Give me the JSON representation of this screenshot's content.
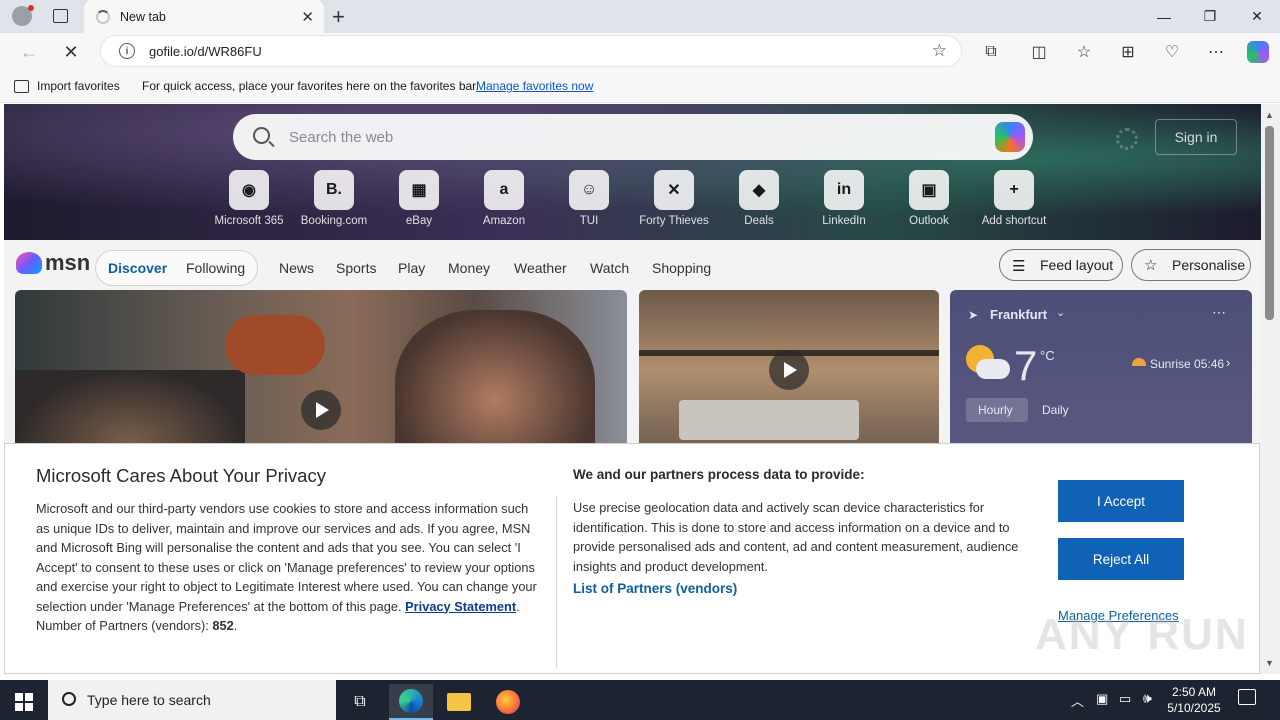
{
  "browser": {
    "tab_title": "New tab",
    "url": "gofile.io/d/WR86FU",
    "favorites": {
      "import_label": "Import favorites",
      "message": "For quick access, place your favorites here on the favorites bar.",
      "manage_link": "Manage favorites now"
    }
  },
  "newtab": {
    "search_placeholder": "Search the web",
    "signin_label": "Sign in",
    "shortcuts": [
      {
        "label": "Microsoft 365",
        "glyph": "◉"
      },
      {
        "label": "Booking.com",
        "glyph": "B."
      },
      {
        "label": "eBay",
        "glyph": "▦"
      },
      {
        "label": "Amazon",
        "glyph": "a"
      },
      {
        "label": "TUI",
        "glyph": "☺"
      },
      {
        "label": "Forty Thieves",
        "glyph": "✕"
      },
      {
        "label": "Deals",
        "glyph": "◆"
      },
      {
        "label": "LinkedIn",
        "glyph": "in"
      },
      {
        "label": "Outlook",
        "glyph": "▣"
      },
      {
        "label": "Add shortcut",
        "glyph": "+"
      }
    ]
  },
  "msn": {
    "logo": "msn",
    "tabs": [
      "Discover",
      "Following"
    ],
    "nav": [
      "News",
      "Sports",
      "Play",
      "Money",
      "Weather",
      "Watch",
      "Shopping"
    ],
    "feed_layout": "Feed layout",
    "personalise": "Personalise"
  },
  "weather": {
    "location": "Frankfurt",
    "temp": "7",
    "unit": "°C",
    "sunrise": "Sunrise 05:46",
    "tabs": [
      "Hourly",
      "Daily"
    ]
  },
  "privacy": {
    "title": "Microsoft Cares About Your Privacy",
    "body": "Microsoft and our third-party vendors use cookies to store and access information such as unique IDs to deliver, maintain and improve our services and ads. If you agree, MSN and Microsoft Bing will personalise the content and ads that you see. You can select 'I Accept' to consent to these uses or click on 'Manage preferences' to review your options and exercise your right to object to Legitimate Interest where used.  You can change your selection under 'Manage Preferences' at the bottom of this page.",
    "privacy_link": "Privacy Statement",
    "partners_count_label": "Number of Partners (vendors):",
    "partners_count": "852",
    "purposes_title": "We and our partners process data to provide:",
    "purposes_text": "Use precise geolocation data and actively scan device characteristics for identification. This is done to store and access information on a device and to provide personalised ads and content, ad and content measurement, audience insights and product development.",
    "partners_link": "List of Partners (vendors)",
    "accept": "I Accept",
    "reject": "Reject All",
    "manage": "Manage Preferences"
  },
  "taskbar": {
    "search_placeholder": "Type here to search",
    "time": "2:50 AM",
    "date": "5/10/2025"
  },
  "watermark": "ANY RUN"
}
